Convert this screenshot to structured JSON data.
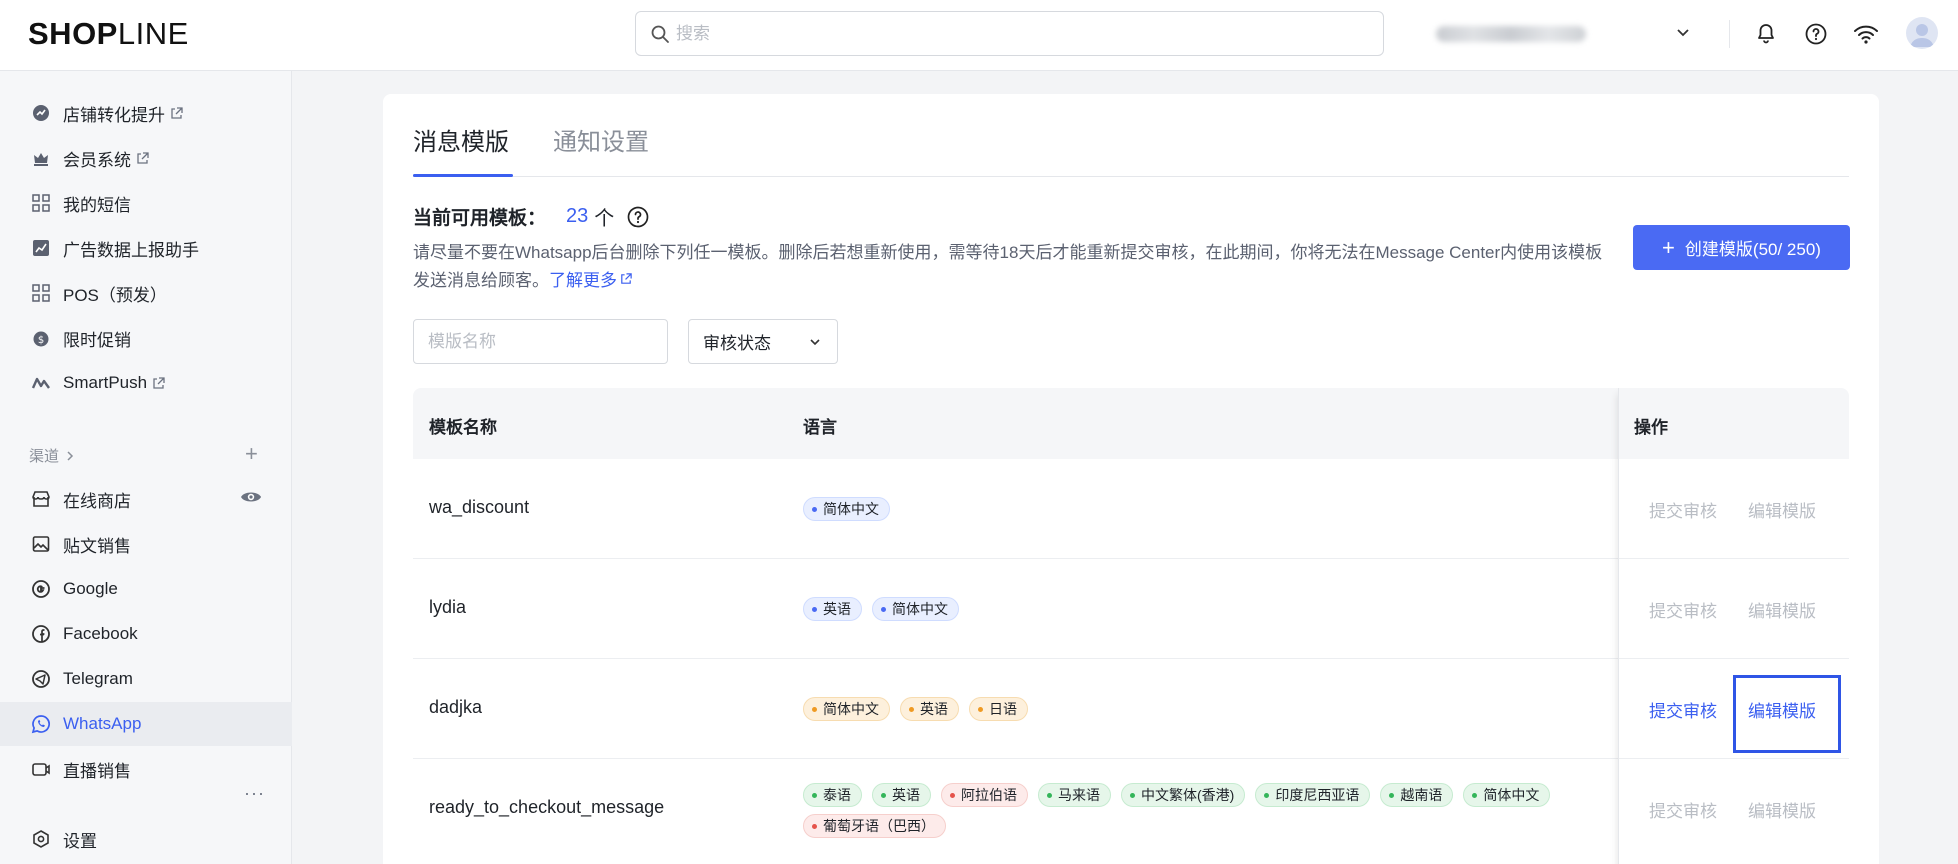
{
  "topbar": {
    "logo_bold": "SHOP",
    "logo_thin": "LINE",
    "search_placeholder": "搜索"
  },
  "sidebar": {
    "items_top": [
      {
        "label": "店铺转化提升",
        "icon": "chart-boost-icon",
        "external": true
      },
      {
        "label": "会员系统",
        "icon": "crown-icon",
        "external": true
      },
      {
        "label": "我的短信",
        "icon": "apps-icon",
        "external": false
      },
      {
        "label": "广告数据上报助手",
        "icon": "chart-icon",
        "external": false
      },
      {
        "label": "POS（预发）",
        "icon": "apps-icon",
        "external": false
      },
      {
        "label": "限时促销",
        "icon": "timer-icon",
        "external": false
      },
      {
        "label": "SmartPush",
        "icon": "smartpush-icon",
        "external": true
      }
    ],
    "channels_label": "渠道",
    "channels": [
      {
        "label": "在线商店",
        "icon": "store-icon"
      },
      {
        "label": "贴文销售",
        "icon": "image-icon"
      },
      {
        "label": "Google",
        "icon": "google-icon"
      },
      {
        "label": "Facebook",
        "icon": "facebook-icon"
      },
      {
        "label": "Telegram",
        "icon": "telegram-icon"
      },
      {
        "label": "WhatsApp",
        "icon": "whatsapp-icon",
        "active": true
      },
      {
        "label": "直播销售",
        "icon": "live-icon"
      }
    ],
    "settings_label": "设置"
  },
  "main": {
    "tabs": [
      {
        "label": "消息模版",
        "active": true
      },
      {
        "label": "通知设置",
        "active": false
      }
    ],
    "count_label": "当前可用模板：",
    "count_value": "23",
    "count_unit": "个",
    "notice_text": "请尽量不要在Whatsapp后台删除下列任一模板。删除后若想重新使用，需等待18天后才能重新提交审核，在此期间，你将无法在Message Center内使用该模板发送消息给顾客。",
    "notice_link": "了解更多",
    "create_button": "创建模版(50/ 250)",
    "filter_name_placeholder": "模版名称",
    "filter_status_label": "审核状态",
    "table": {
      "headers": {
        "name": "模板名称",
        "language": "语言",
        "ops": "操作"
      },
      "op_submit": "提交审核",
      "op_edit": "编辑模版",
      "rows": [
        {
          "name": "wa_discount",
          "tags": [
            {
              "label": "简体中文",
              "color": "blue"
            }
          ],
          "ops_enabled": false
        },
        {
          "name": "lydia",
          "tags": [
            {
              "label": "英语",
              "color": "blue"
            },
            {
              "label": "简体中文",
              "color": "blue"
            }
          ],
          "ops_enabled": false
        },
        {
          "name": "dadjka",
          "tags": [
            {
              "label": "简体中文",
              "color": "orange"
            },
            {
              "label": "英语",
              "color": "orange"
            },
            {
              "label": "日语",
              "color": "orange"
            }
          ],
          "ops_enabled": true
        },
        {
          "name": "ready_to_checkout_message",
          "tags": [
            {
              "label": "泰语",
              "color": "green"
            },
            {
              "label": "英语",
              "color": "green"
            },
            {
              "label": "阿拉伯语",
              "color": "red"
            },
            {
              "label": "马来语",
              "color": "green"
            },
            {
              "label": "中文繁体(香港)",
              "color": "green"
            },
            {
              "label": "印度尼西亚语",
              "color": "green"
            },
            {
              "label": "越南语",
              "color": "green"
            },
            {
              "label": "简体中文",
              "color": "green"
            },
            {
              "label": "葡萄牙语（巴西）",
              "color": "red"
            }
          ],
          "ops_enabled": false
        }
      ]
    }
  }
}
